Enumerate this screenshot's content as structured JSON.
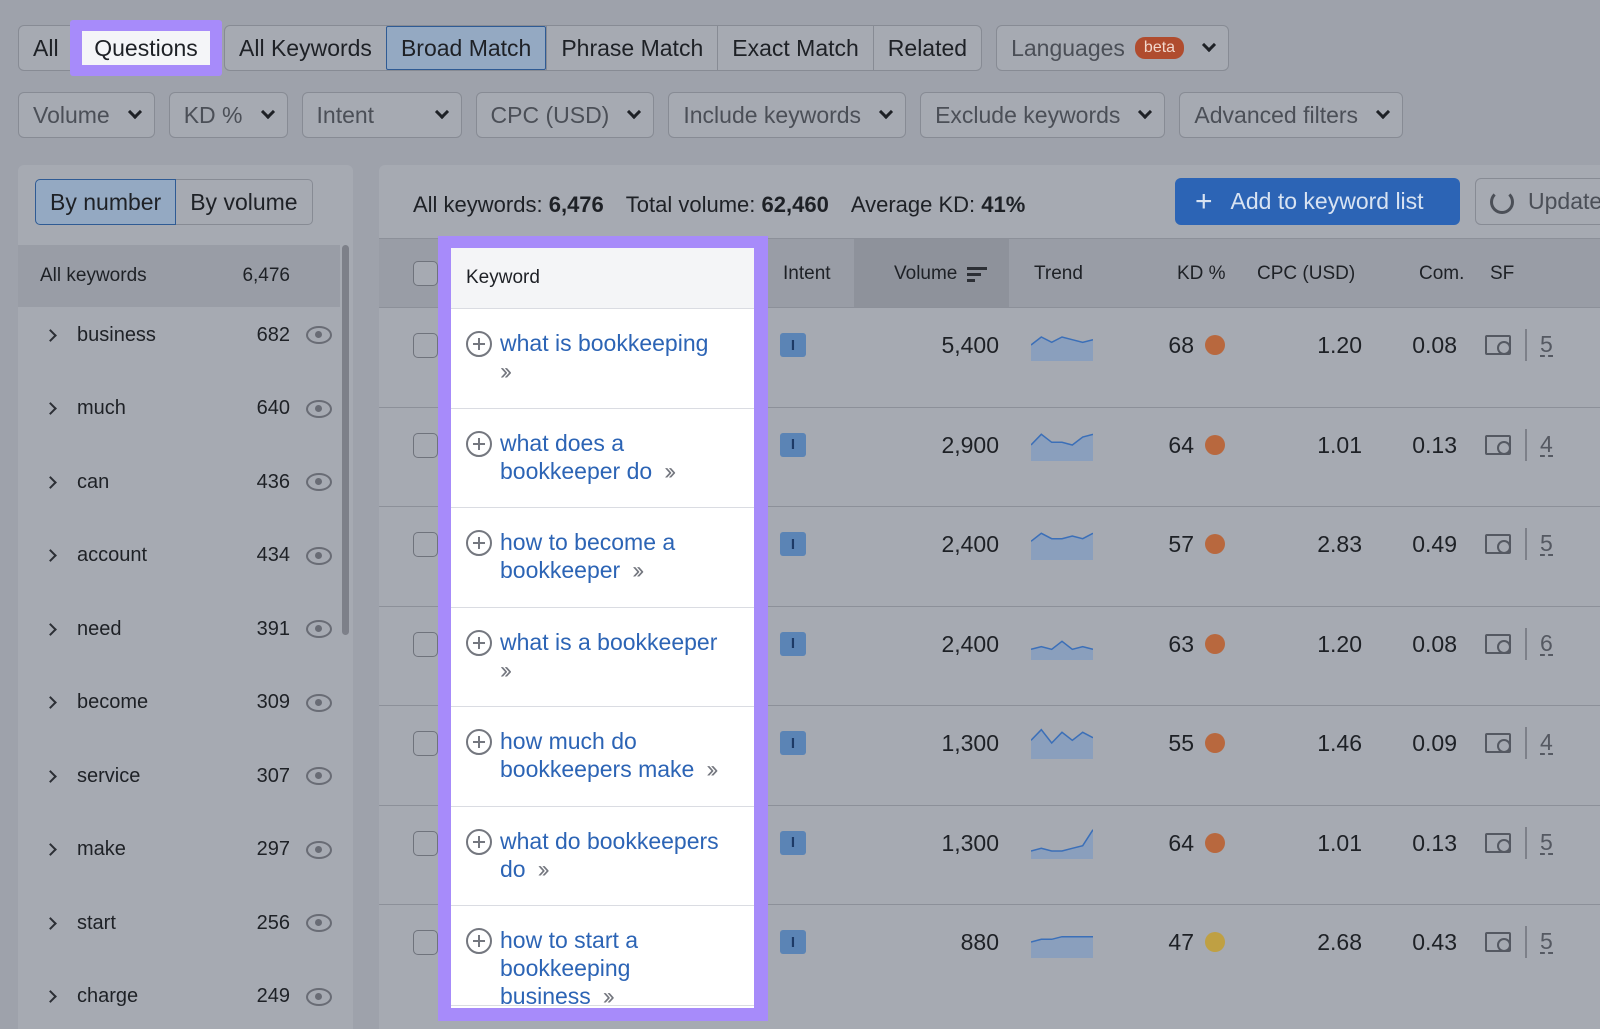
{
  "tabs_left": [
    "All",
    "Questions"
  ],
  "tabs_match": [
    "All Keywords",
    "Broad Match",
    "Phrase Match",
    "Exact Match",
    "Related"
  ],
  "languages": {
    "label": "Languages",
    "badge": "beta"
  },
  "filters": [
    "Volume",
    "KD %",
    "Intent",
    "CPC (USD)",
    "Include keywords",
    "Exclude keywords",
    "Advanced filters"
  ],
  "sidebar": {
    "toggle": [
      "By number",
      "By volume"
    ],
    "all": {
      "label": "All keywords",
      "count": "6,476"
    },
    "groups": [
      {
        "label": "business",
        "count": "682"
      },
      {
        "label": "much",
        "count": "640"
      },
      {
        "label": "can",
        "count": "436"
      },
      {
        "label": "account",
        "count": "434"
      },
      {
        "label": "need",
        "count": "391"
      },
      {
        "label": "become",
        "count": "309"
      },
      {
        "label": "service",
        "count": "307"
      },
      {
        "label": "make",
        "count": "297"
      },
      {
        "label": "start",
        "count": "256"
      },
      {
        "label": "charge",
        "count": "249"
      }
    ]
  },
  "summary": {
    "all_label": "All keywords:",
    "all_value": "6,476",
    "vol_label": "Total volume:",
    "vol_value": "62,460",
    "kd_label": "Average KD:",
    "kd_value": "41%"
  },
  "buttons": {
    "add": "Add to keyword list",
    "update": "Update"
  },
  "columns": {
    "keyword": "Keyword",
    "intent": "Intent",
    "volume": "Volume",
    "trend": "Trend",
    "kd": "KD %",
    "cpc": "CPC (USD)",
    "com": "Com.",
    "sf": "SF"
  },
  "rows": [
    {
      "l1": "what is bookkeeping",
      "l2": "",
      "l3": "",
      "intent": "I",
      "volume": "5,400",
      "kd": "68",
      "kd_color": "#b8683e",
      "cpc": "1.20",
      "com": "0.08",
      "sf": "5",
      "trend": [
        6,
        9,
        7,
        9,
        8,
        7,
        8
      ]
    },
    {
      "l1": "what does a",
      "l2": "bookkeeper do",
      "l3": "",
      "intent": "I",
      "volume": "2,900",
      "kd": "64",
      "kd_color": "#b8683e",
      "cpc": "1.01",
      "com": "0.13",
      "sf": "4",
      "trend": [
        6,
        10,
        7,
        7,
        6,
        9,
        10
      ]
    },
    {
      "l1": "how to become a",
      "l2": "bookkeeper",
      "l3": "",
      "intent": "I",
      "volume": "2,400",
      "kd": "57",
      "kd_color": "#b8683e",
      "cpc": "2.83",
      "com": "0.49",
      "sf": "5",
      "trend": [
        7,
        10,
        8,
        8,
        9,
        8,
        10
      ]
    },
    {
      "l1": "what is a bookkeeper",
      "l2": "",
      "l3": "",
      "intent": "I",
      "volume": "2,400",
      "kd": "63",
      "kd_color": "#b8683e",
      "cpc": "1.20",
      "com": "0.08",
      "sf": "6",
      "trend": [
        4,
        5,
        4,
        7,
        4,
        5,
        4
      ]
    },
    {
      "l1": "how much do",
      "l2": "bookkeepers make",
      "l3": "",
      "intent": "I",
      "volume": "1,300",
      "kd": "55",
      "kd_color": "#b8683e",
      "cpc": "1.46",
      "com": "0.09",
      "sf": "4",
      "trend": [
        7,
        11,
        6,
        10,
        7,
        10,
        8
      ]
    },
    {
      "l1": "what do bookkeepers",
      "l2": "do",
      "l3": "",
      "intent": "I",
      "volume": "1,300",
      "kd": "64",
      "kd_color": "#b8683e",
      "cpc": "1.01",
      "com": "0.13",
      "sf": "5",
      "trend": [
        3,
        4,
        3,
        3,
        4,
        5,
        11
      ]
    },
    {
      "l1": "how to start a",
      "l2": "bookkeeping",
      "l3": "business",
      "intent": "I",
      "volume": "880",
      "kd": "47",
      "kd_color": "#bfa043",
      "cpc": "2.68",
      "com": "0.43",
      "sf": "5",
      "trend": [
        6,
        7,
        7,
        8,
        8,
        8,
        8
      ]
    }
  ]
}
